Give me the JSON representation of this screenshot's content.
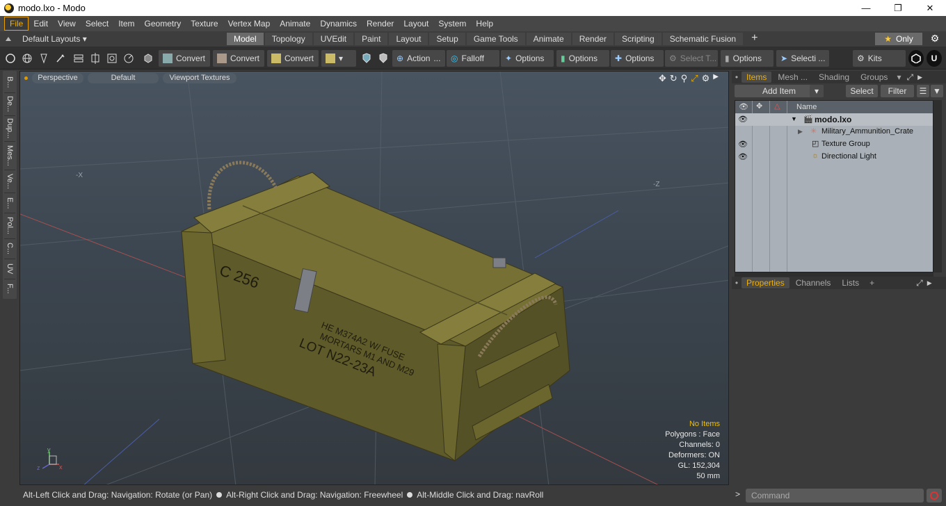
{
  "window": {
    "title": "modo.lxo - Modo"
  },
  "menu": [
    "File",
    "Edit",
    "View",
    "Select",
    "Item",
    "Geometry",
    "Texture",
    "Vertex Map",
    "Animate",
    "Dynamics",
    "Render",
    "Layout",
    "System",
    "Help"
  ],
  "layout_selector": "Default Layouts ▾",
  "layout_tabs": [
    "Model",
    "Topology",
    "UVEdit",
    "Paint",
    "Layout",
    "Setup",
    "Game Tools",
    "Animate",
    "Render",
    "Scripting",
    "Schematic Fusion"
  ],
  "only_label": "Only",
  "toolbar": {
    "convert1": "Convert",
    "convert2": "Convert",
    "convert3": "Convert",
    "action": "Action",
    "action_more": "...",
    "falloff": "Falloff",
    "options1": "Options",
    "options2": "Options",
    "options3": "Options",
    "options4": "Options",
    "select_t": "Select T...",
    "selecti": "Selecti ...",
    "kits": "Kits"
  },
  "left_strip": [
    "B...",
    "De...",
    "Dup...",
    "Mes...",
    "Ve...",
    "E...",
    "Pol...",
    "C...",
    "UV",
    "F..."
  ],
  "viewport": {
    "tabs": [
      "Perspective",
      "Default",
      "Viewport Textures"
    ],
    "stats": {
      "no_items": "No Items",
      "polygons": "Polygons : Face",
      "channels": "Channels: 0",
      "deformers": "Deformers: ON",
      "gl": "GL: 152,304",
      "lens": "50 mm"
    },
    "crate_text": [
      "C 256",
      "HE M374A2 W/ FUSE",
      "MORTARS M1 AND M29",
      "LOT N22-23A"
    ]
  },
  "status": {
    "hint1": "Alt-Left Click and Drag: Navigation: Rotate (or Pan)",
    "hint2": "Alt-Right Click and Drag: Navigation: Freewheel",
    "hint3": "Alt-Middle Click and Drag: navRoll"
  },
  "items_panel": {
    "tabs": [
      "Items",
      "Mesh ...",
      "Shading",
      "Groups"
    ],
    "add_item": "Add Item",
    "select": "Select",
    "filter": "Filter",
    "col_name": "Name",
    "rows": [
      {
        "name": "modo.lxo",
        "eye": true
      },
      {
        "name": "Military_Ammunition_Crate",
        "eye": false
      },
      {
        "name": "Texture Group",
        "eye": true
      },
      {
        "name": "Directional Light",
        "eye": true
      }
    ]
  },
  "props_panel": {
    "tabs": [
      "Properties",
      "Channels",
      "Lists"
    ]
  },
  "command": {
    "placeholder": "Command",
    "prompt": ">"
  }
}
